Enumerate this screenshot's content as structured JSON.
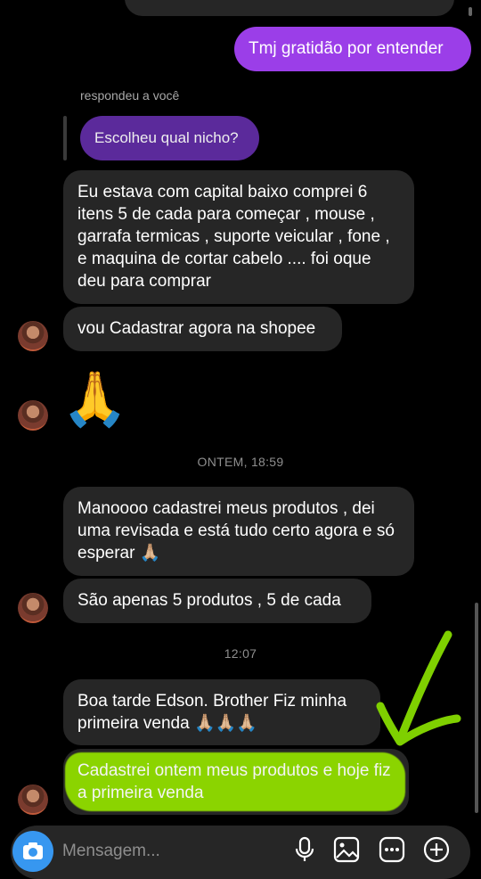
{
  "top_partial": {},
  "messages": {
    "out_1": "Tmj gratidão por entender",
    "reply_label": "respondeu a você",
    "reply_quote": "Escolheu qual nicho?",
    "in_1": "Eu estava com capital baixo comprei 6 itens 5 de cada para começar , mouse , garrafa termicas , suporte veicular , fone , e maquina de cortar cabelo .... foi oque deu para comprar",
    "in_2": "vou Cadastrar agora na shopee",
    "in_3_emoji": "🙏",
    "ts_1": "ONTEM, 18:59",
    "in_4": "Manoooo cadastrei meus produtos , dei uma revisada e está tudo certo agora e só esperar 🙏🏼",
    "in_5": "São apenas 5 produtos , 5 de cada",
    "ts_2": "12:07",
    "in_6": "Boa tarde Edson. Brother Fiz minha primeira venda 🙏🏼🙏🏼🙏🏼",
    "in_7": "Cadastrei ontem meus produtos e hoje fiz a primeira venda"
  },
  "composer": {
    "placeholder": "Mensagem...",
    "camera_icon": "camera-icon",
    "mic_icon": "microphone-icon",
    "gallery_icon": "image-icon",
    "sticker_icon": "sticker-icon",
    "add_icon": "plus-circle-icon"
  },
  "colors": {
    "background": "#000000",
    "incoming_bubble": "#262626",
    "outgoing_bubble": "#9b3ee8",
    "reply_quote_bubble": "#5b2a9b",
    "highlight": "#8bd400",
    "arrow": "#7fd000",
    "timestamp": "#8e8e8e"
  }
}
